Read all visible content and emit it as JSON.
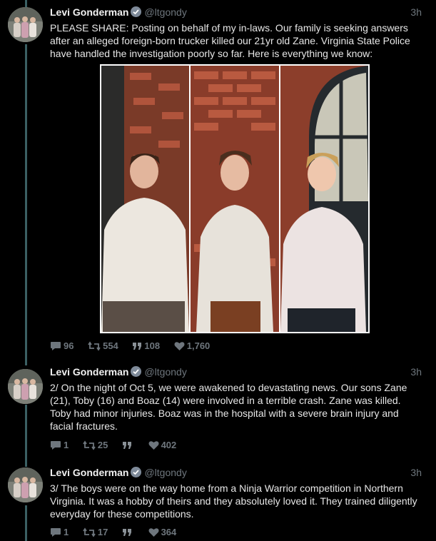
{
  "author": {
    "name": "Levi Gonderman",
    "handle": "@ltgondy"
  },
  "tweets": [
    {
      "time": "3h",
      "text": "PLEASE SHARE: Posting on behalf of my in-laws. Our family is seeking answers after an alleged foreign-born trucker killed our 21yr old Zane. Virginia State Police have handled the investigation poorly so far. Here is everything we know:",
      "replies": "96",
      "retweets": "554",
      "quotes": "108",
      "likes": "1,760"
    },
    {
      "time": "3h",
      "text": "2/ On the night of Oct 5, we were awakened to devastating news. Our sons Zane (21), Toby (16) and Boaz (14) were involved in a terrible crash. Zane was killed. Toby had minor injuries. Boaz was in the hospital with a severe brain injury and facial fractures.",
      "replies": "1",
      "retweets": "25",
      "quotes": "",
      "likes": "402"
    },
    {
      "time": "3h",
      "text": "3/ The boys were on the way home from a Ninja Warrior competition in Northern Virginia. It was a hobby of theirs and they absolutely loved it. They trained diligently everyday for these competitions.",
      "replies": "1",
      "retweets": "17",
      "quotes": "",
      "likes": "364"
    }
  ],
  "icons": {
    "reply": "reply-icon",
    "retweet": "retweet-icon",
    "quote": "quote-icon",
    "like": "heart-icon",
    "verified": "verified-badge-icon"
  },
  "colors": {
    "background": "#000000",
    "thread_line": "#3b5f63",
    "muted": "#6e767d",
    "verified_badge": "#7e8a99"
  }
}
